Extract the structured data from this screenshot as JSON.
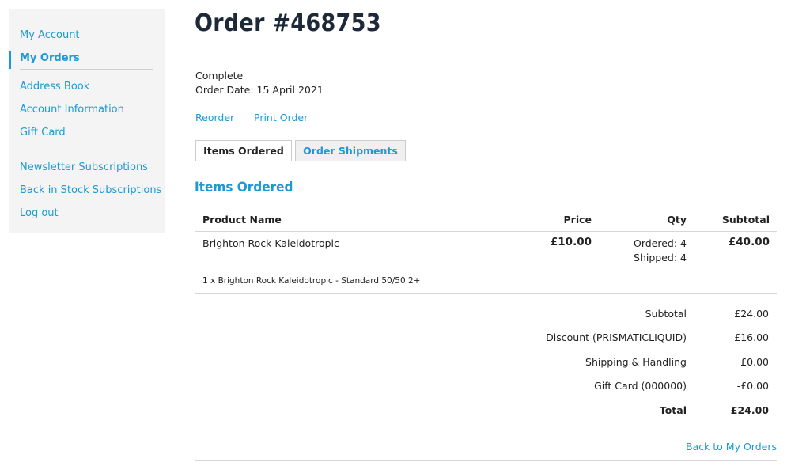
{
  "sidebar": {
    "items": [
      {
        "label": "My Account"
      },
      {
        "label": "My Orders"
      },
      {
        "label": "Address Book"
      },
      {
        "label": "Account Information"
      },
      {
        "label": "Gift Card"
      },
      {
        "label": "Newsletter Subscriptions"
      },
      {
        "label": "Back in Stock Subscriptions"
      },
      {
        "label": "Log out"
      }
    ],
    "active": "My Orders"
  },
  "order": {
    "title": "Order #468753",
    "status": "Complete",
    "date": "Order Date: 15 April 2021",
    "actions": {
      "reorder": "Reorder",
      "print": "Print Order"
    }
  },
  "tabs": [
    {
      "label": "Items Ordered",
      "active": true
    },
    {
      "label": "Order Shipments",
      "active": false
    }
  ],
  "items_section": {
    "title": "Items Ordered",
    "columns": [
      "Product Name",
      "Price",
      "Qty",
      "Subtotal"
    ],
    "rows": [
      {
        "name": "Brighton Rock Kaleidotropic",
        "price": "£10.00",
        "qty_ordered": "Ordered: 4",
        "qty_shipped": "Shipped: 4",
        "subtotal": "£40.00",
        "option": "1 x Brighton Rock Kaleidotropic - Standard 50/50 2+"
      }
    ]
  },
  "totals": [
    {
      "label": "Subtotal",
      "value": "£24.00"
    },
    {
      "label": "Discount (PRISMATICLIQUID)",
      "value": "£16.00"
    },
    {
      "label": "Shipping & Handling",
      "value": "£0.00"
    },
    {
      "label": "Gift Card (000000)",
      "value": "-£0.00"
    },
    {
      "label": "Total",
      "value": "£24.00"
    }
  ],
  "back_link": "Back to My Orders",
  "colors": {
    "accent": "#1a9ad6",
    "title": "#1d2838",
    "sidebar_bg": "#f4f4f4"
  }
}
